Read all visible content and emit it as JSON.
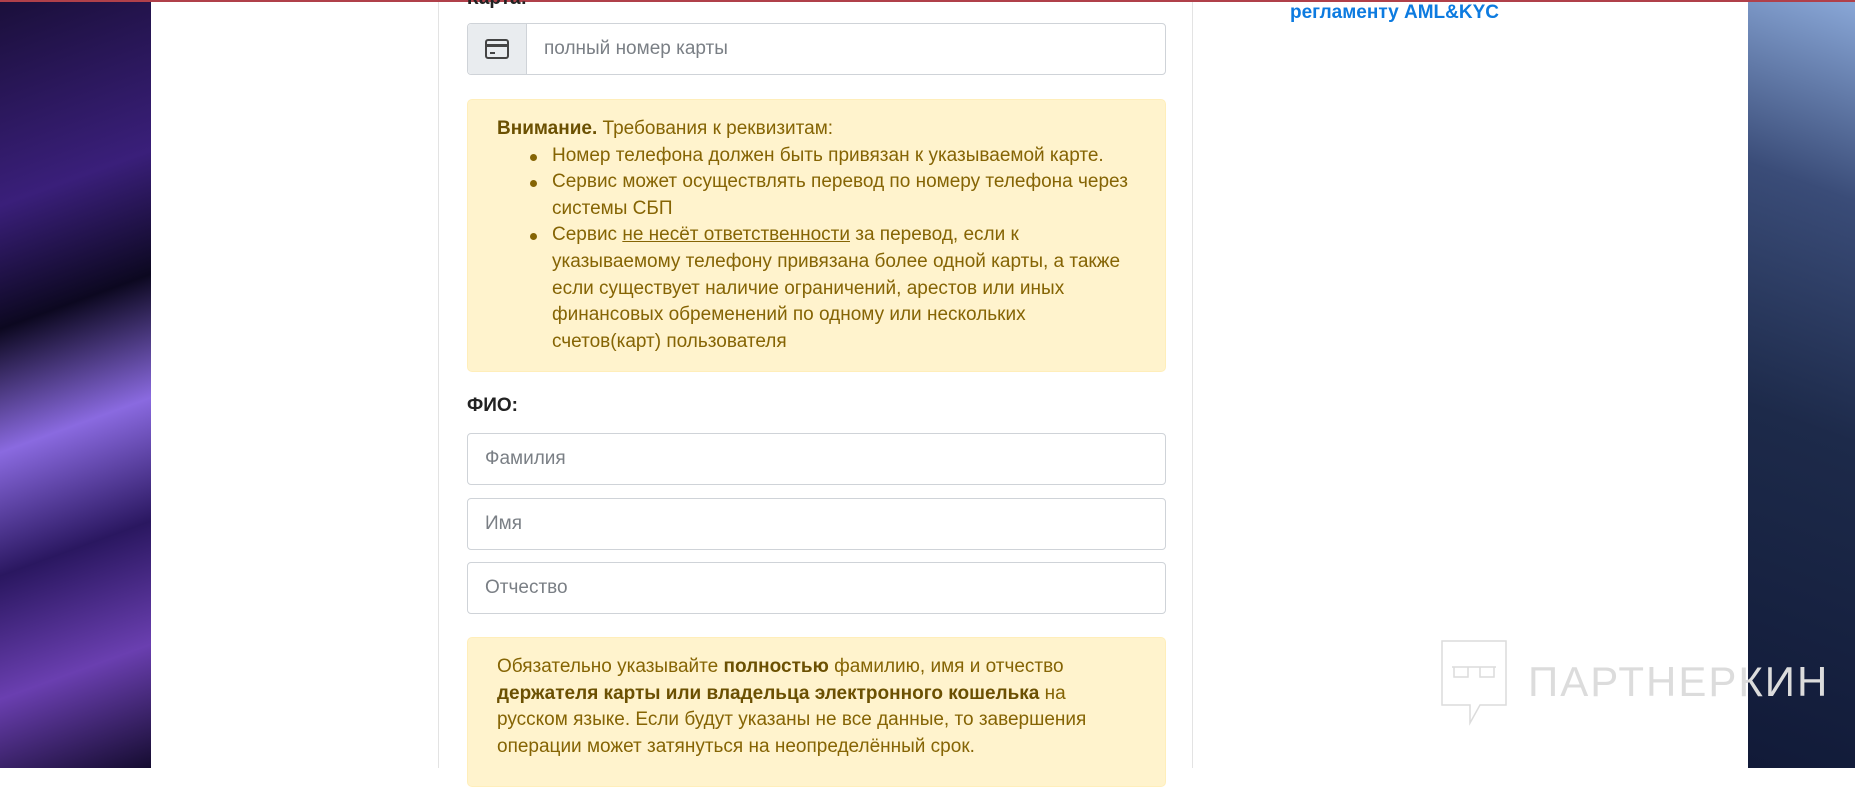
{
  "card": {
    "label": "Карта:",
    "placeholder": "полный номер карты",
    "icon": "credit-card-icon"
  },
  "warning": {
    "title": "Внимание.",
    "intro": " Требования к реквизитам:",
    "items": [
      {
        "text": "Номер телефона должен быть привязан к указываемой карте."
      },
      {
        "text": "Сервис может осуществлять перевод по номеру телефона через системы СБП"
      },
      {
        "pre": "Сервис ",
        "underlined": "не несёт ответственности",
        "post": " за перевод, если к указываемому телефону привязана более одной карты, а также если существует наличие ограничений, арестов или иных финансовых обременений по одному или нескольких счетов(карт) пользователя"
      }
    ]
  },
  "fio": {
    "label": "ФИО:",
    "surname_placeholder": "Фамилия",
    "name_placeholder": "Имя",
    "patronymic_placeholder": "Отчество"
  },
  "notice": {
    "p1": "Обязательно указывайте ",
    "b1": "полностью",
    "p2": " фамилию, имя и отчество ",
    "b2": "держателя карты или владельца электронного кошелька",
    "p3": " на русском языке. Если будут указаны не все данные, то завершения операции может затянуться на неопределённый срок."
  },
  "sidebar": {
    "aml_link": "регламенту AML&KYC"
  },
  "watermark": {
    "text": "ПАРТНЕРКИН"
  },
  "colors": {
    "alert_bg": "#fff3cd",
    "alert_text": "#856404",
    "link": "#0d7be0"
  }
}
